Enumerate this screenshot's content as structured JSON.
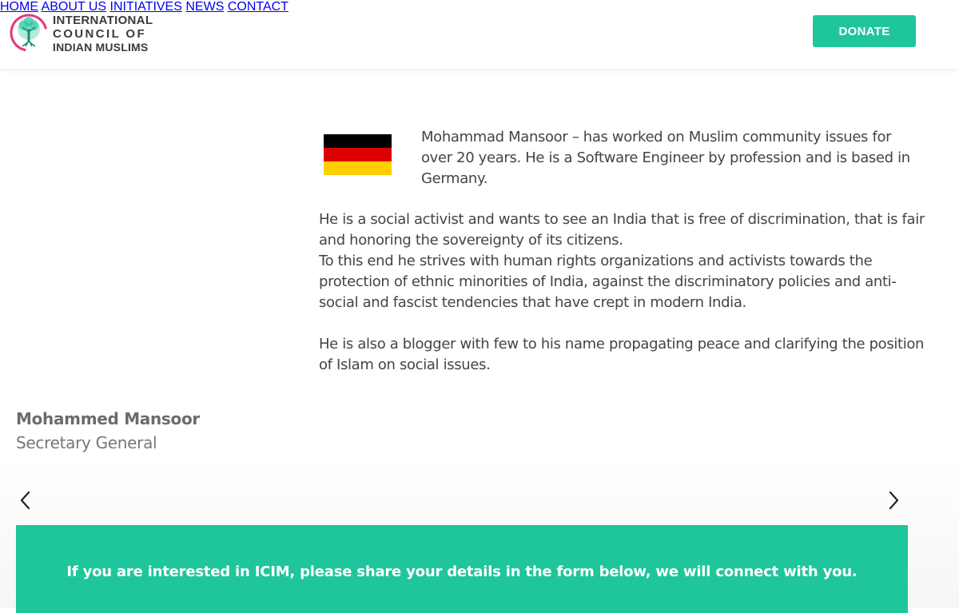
{
  "brand": {
    "line1": "INTERNATIONAL",
    "line2": "COUNCIL OF",
    "line3": "INDIAN MUSLIMS",
    "logo_icon": "tree-icon",
    "accent_color": "#1fc69b",
    "logo_ring_color": "#e8357a"
  },
  "nav": {
    "items": [
      {
        "label": "HOME"
      },
      {
        "label": "ABOUT US"
      },
      {
        "label": "INITIATIVES"
      },
      {
        "label": "NEWS"
      },
      {
        "label": "CONTACT"
      }
    ],
    "donate_label": "DONATE"
  },
  "profile": {
    "flag": "germany-flag",
    "flag_colors": [
      "#000000",
      "#dd0000",
      "#ffce00"
    ],
    "bio_1": "Mohammad Mansoor – has worked on Muslim community issues for over 20 years. He is a Software Engineer by profession and is based in Germany.",
    "bio_2a": "He is a social activist and wants to see an India that is free of discrimination, that is fair and honoring the sovereignty of its citizens.",
    "bio_2b": "To this end he strives with human rights organizations and activists towards the protection of ethnic minorities of India, against the discriminatory policies and anti-social and fascist tendencies that have crept in modern India.",
    "bio_3": "He is also a blogger with few to his name propagating peace and clarifying the position of Islam on social issues.",
    "name": "Mohammed Mansoor",
    "role": "Secretary General"
  },
  "carousel": {
    "prev_icon": "chevron-left-icon",
    "next_icon": "chevron-right-icon"
  },
  "cta": {
    "text": "If you are interested in ICIM, please share your details in the form below, we will connect with you."
  }
}
